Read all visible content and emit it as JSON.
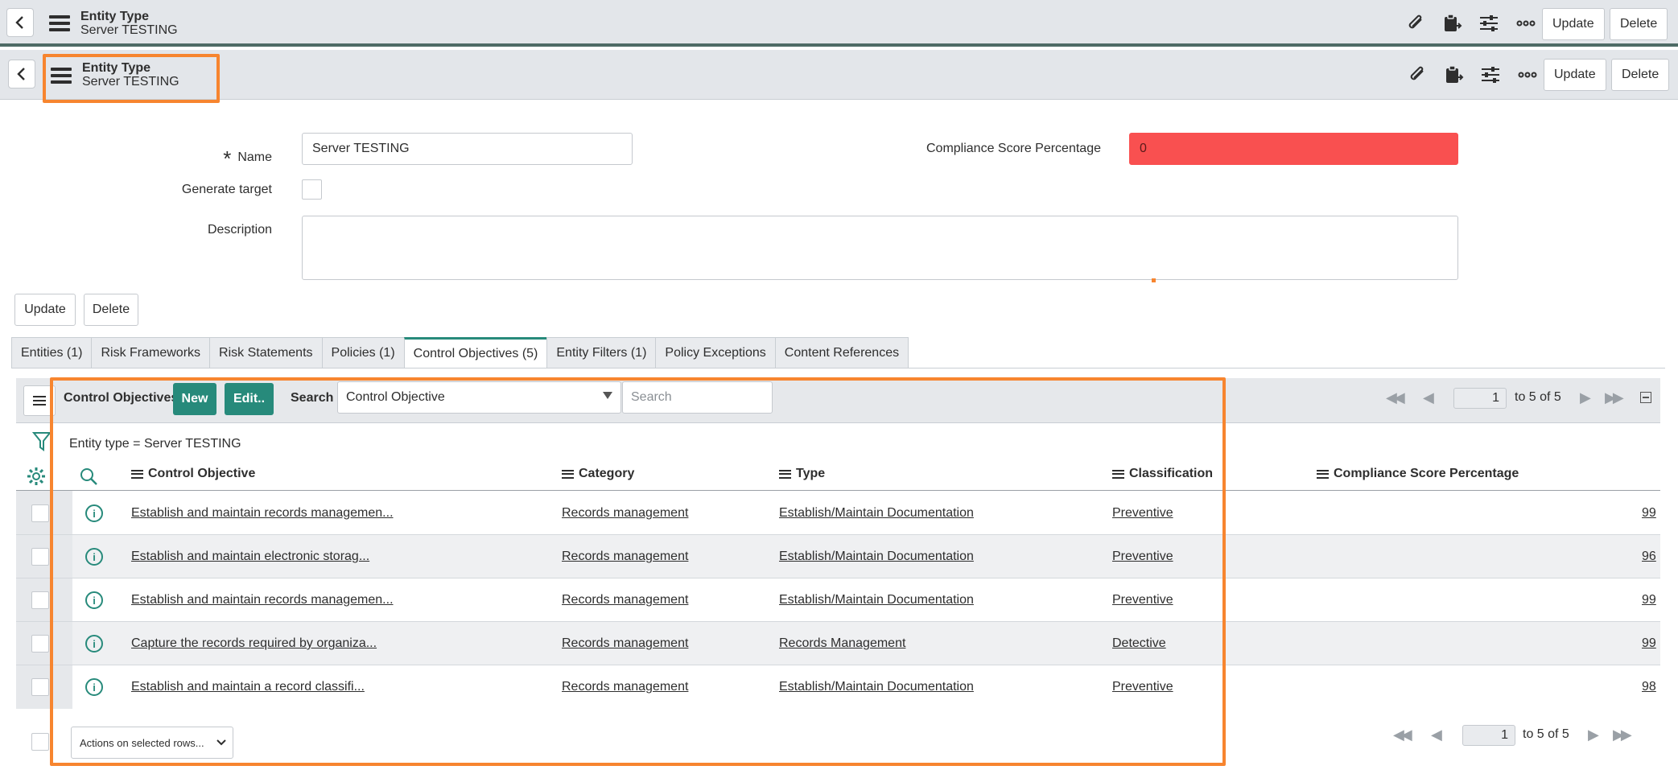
{
  "header": {
    "title": "Entity Type",
    "subtitle": "Server TESTING",
    "update_label": "Update",
    "delete_label": "Delete"
  },
  "form": {
    "name_label": "Name",
    "name_value": "Server TESTING",
    "compliance_label": "Compliance Score Percentage",
    "compliance_value": "0",
    "generate_target_label": "Generate target",
    "description_label": "Description",
    "update_label": "Update",
    "delete_label": "Delete"
  },
  "tabs": [
    {
      "label": "Entities (1)"
    },
    {
      "label": "Risk Frameworks"
    },
    {
      "label": "Risk Statements"
    },
    {
      "label": "Policies (1)"
    },
    {
      "label": "Control Objectives (5)",
      "active": true
    },
    {
      "label": "Entity Filters (1)"
    },
    {
      "label": "Policy Exceptions"
    },
    {
      "label": "Content References"
    }
  ],
  "list": {
    "title": "Control Objectives",
    "new_label": "New",
    "edit_label": "Edit..",
    "search_label": "Search",
    "search_field": "Control Objective",
    "search_placeholder": "Search",
    "page": "1",
    "range_text": "to 5 of 5",
    "filter_text": "Entity type = Server TESTING",
    "columns": [
      "Control Objective",
      "Category",
      "Type",
      "Classification",
      "Compliance Score Percentage"
    ],
    "rows": [
      {
        "objective": "Establish and maintain records managemen...",
        "category": "Records management",
        "type": "Establish/Maintain Documentation",
        "classification": "Preventive",
        "score": "99"
      },
      {
        "objective": "Establish and maintain electronic storag...",
        "category": "Records management",
        "type": "Establish/Maintain Documentation",
        "classification": "Preventive",
        "score": "96"
      },
      {
        "objective": "Establish and maintain records managemen...",
        "category": "Records management",
        "type": "Establish/Maintain Documentation",
        "classification": "Preventive",
        "score": "99"
      },
      {
        "objective": "Capture the records required by organiza...",
        "category": "Records management",
        "type": "Records Management",
        "classification": "Detective",
        "score": "99"
      },
      {
        "objective": "Establish and maintain a record classifi...",
        "category": "Records management",
        "type": "Establish/Maintain Documentation",
        "classification": "Preventive",
        "score": "98"
      }
    ],
    "actions_label": "Actions on selected rows..."
  },
  "colors": {
    "accent": "#278a7b",
    "highlight": "#f7852f",
    "compliance_bg": "#f95050"
  },
  "icons": [
    "back-arrow-icon",
    "menu-icon",
    "paperclip-icon",
    "clipboard-icon",
    "sliders-icon",
    "more-icon",
    "filter-icon",
    "gear-icon",
    "search-icon",
    "info-icon",
    "first-page-icon",
    "prev-page-icon",
    "next-page-icon",
    "last-page-icon",
    "collapse-icon",
    "chevron-down-icon"
  ]
}
